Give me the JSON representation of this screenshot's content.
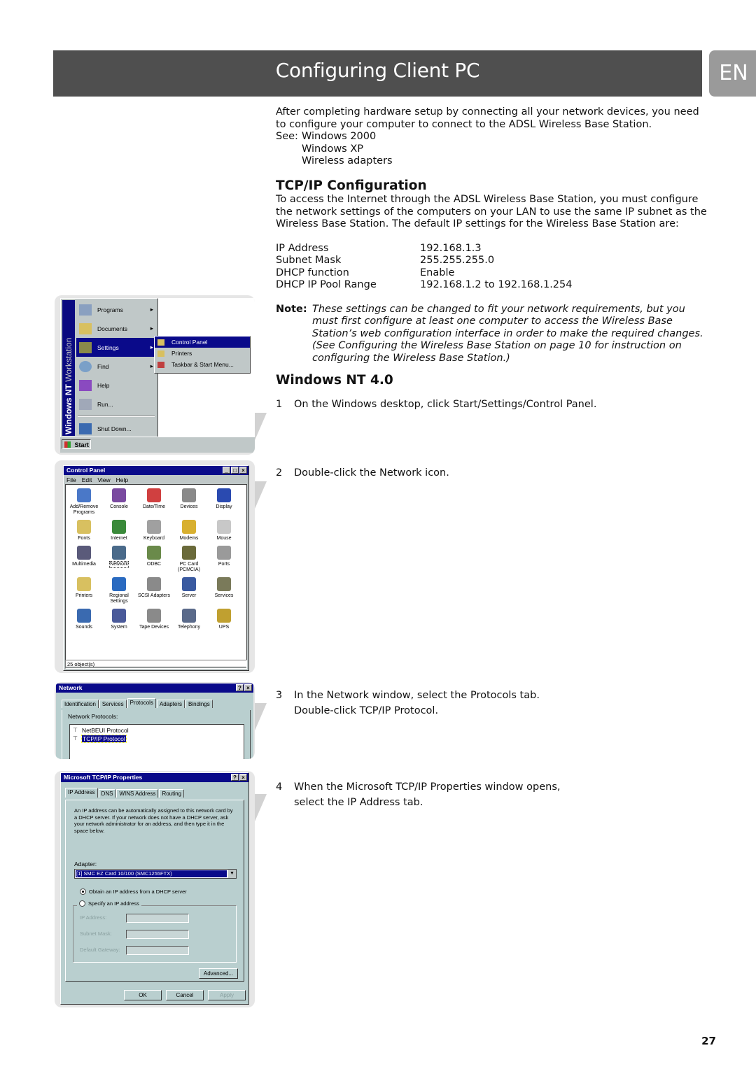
{
  "header": {
    "title": "Configuring Client PC",
    "language_badge": "EN"
  },
  "intro": {
    "paragraph": "After completing hardware setup by connecting all your network devices, you need to configure your computer to connect to the ADSL Wireless Base Station.",
    "see_label": "See:",
    "see_items": [
      "Windows 2000",
      "Windows XP",
      "Wireless adapters"
    ]
  },
  "tcpip": {
    "heading": "TCP/IP Configuration",
    "paragraph": "To access the Internet through the ADSL Wireless Base Station, you must configure the network settings of the computers on your LAN to use the same IP subnet as the Wireless Base Station. The default IP settings for the Wireless Base Station are:",
    "settings": [
      {
        "label": "IP Address",
        "value": "192.168.1.3"
      },
      {
        "label": "Subnet Mask",
        "value": "255.255.255.0"
      },
      {
        "label": "DHCP function",
        "value": "Enable"
      },
      {
        "label": "DHCP IP Pool Range",
        "value": "192.168.1.2 to 192.168.1.254"
      }
    ],
    "note_label": "Note:",
    "note_text": "These settings can be changed to fit your network requirements, but you must first configure at least one computer to access the Wireless Base Station’s web configuration interface in order to make the required changes. (See  Configuring the Wireless Base Station  on page 10 for instruction on configuring the Wireless Base Station.)"
  },
  "winnt": {
    "heading": "Windows NT 4.0",
    "steps": [
      {
        "num": "1",
        "lines": [
          "On the Windows desktop, click Start/Settings/Control Panel."
        ]
      },
      {
        "num": "2",
        "lines": [
          "Double-click the Network icon."
        ]
      },
      {
        "num": "3",
        "lines": [
          "In the Network window, select the Protocols tab.",
          "Double-click TCP/IP Protocol."
        ]
      },
      {
        "num": "4",
        "lines": [
          "When the Microsoft TCP/IP Properties window opens,",
          "select the IP Address tab."
        ]
      }
    ]
  },
  "start_menu": {
    "banner_bold": "Windows NT",
    "banner_light": "Workstation",
    "items": [
      "Programs",
      "Documents",
      "Settings",
      "Find",
      "Help",
      "Run...",
      "Shut Down..."
    ],
    "submenu": [
      "Control Panel",
      "Printers",
      "Taskbar & Start Menu..."
    ],
    "start_button": "Start"
  },
  "control_panel": {
    "title": "Control Panel",
    "menu": [
      "File",
      "Edit",
      "View",
      "Help"
    ],
    "items": [
      {
        "label": "Add/Remove Programs",
        "color": "#4a78c8"
      },
      {
        "label": "Console",
        "color": "#7a4aa0"
      },
      {
        "label": "Date/Time",
        "color": "#d04040"
      },
      {
        "label": "Devices",
        "color": "#8a8a8a"
      },
      {
        "label": "Display",
        "color": "#2a4ab0"
      },
      {
        "label": "Fonts",
        "color": "#d8c060"
      },
      {
        "label": "Internet",
        "color": "#3a8a3a"
      },
      {
        "label": "Keyboard",
        "color": "#a0a0a0"
      },
      {
        "label": "Modems",
        "color": "#d8b030"
      },
      {
        "label": "Mouse",
        "color": "#c8c8c8"
      },
      {
        "label": "Multimedia",
        "color": "#5a5a7a"
      },
      {
        "label": "Network",
        "color": "#4a6a8a"
      },
      {
        "label": "ODBC",
        "color": "#6a8a4a"
      },
      {
        "label": "PC Card (PCMCIA)",
        "color": "#6a6a3a"
      },
      {
        "label": "Ports",
        "color": "#9a9a9a"
      },
      {
        "label": "Printers",
        "color": "#d8c060"
      },
      {
        "label": "Regional Settings",
        "color": "#2a6ac0"
      },
      {
        "label": "SCSI Adapters",
        "color": "#8a8a8a"
      },
      {
        "label": "Server",
        "color": "#3a5aa0"
      },
      {
        "label": "Services",
        "color": "#7a7a5a"
      },
      {
        "label": "Sounds",
        "color": "#3a6ab0"
      },
      {
        "label": "System",
        "color": "#4a5a9a"
      },
      {
        "label": "Tape Devices",
        "color": "#8a8a8a"
      },
      {
        "label": "Telephony",
        "color": "#5a6a8a"
      },
      {
        "label": "UPS",
        "color": "#c0a030"
      }
    ],
    "status": "25 object(s)"
  },
  "network_window": {
    "title": "Network",
    "tabs": [
      "Identification",
      "Services",
      "Protocols",
      "Adapters",
      "Bindings"
    ],
    "active_tab": "Protocols",
    "list_label": "Network Protocols:",
    "protocols": [
      "NetBEUI Protocol",
      "TCP/IP Protocol"
    ],
    "selected_protocol": "TCP/IP Protocol"
  },
  "tcpip_window": {
    "title": "Microsoft TCP/IP Properties",
    "tabs": [
      "IP Address",
      "DNS",
      "WINS Address",
      "Routing"
    ],
    "active_tab": "IP Address",
    "description": "An IP address can be automatically assigned to this network card by a DHCP server.  If your network does not have a DHCP server, ask your network administrator for an address, and then type it in the space below.",
    "adapter_label": "Adapter:",
    "adapter_value": "[1] SMC EZ Card 10/100 (SMC1255FTX)",
    "radio_dhcp": "Obtain an IP address from a DHCP server",
    "radio_specify": "Specify an IP address",
    "fields": [
      "IP Address:",
      "Subnet Mask:",
      "Default Gateway:"
    ],
    "advanced_button": "Advanced...",
    "ok_button": "OK",
    "cancel_button": "Cancel",
    "apply_button": "Apply"
  },
  "footer": {
    "page_number": "27"
  }
}
